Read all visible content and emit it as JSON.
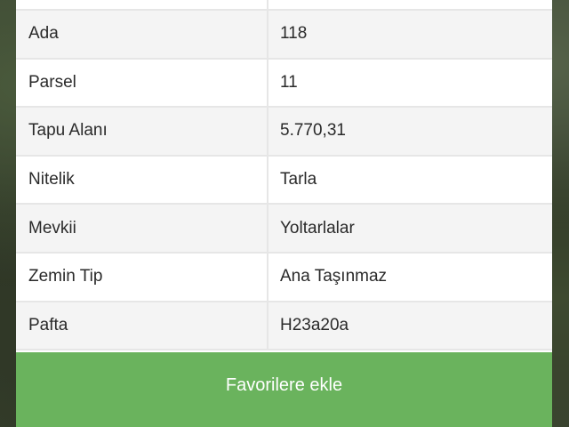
{
  "parcel_info": {
    "rows": [
      {
        "label": "",
        "value": ""
      },
      {
        "label": "Ada",
        "value": "118"
      },
      {
        "label": "Parsel",
        "value": "11"
      },
      {
        "label": "Tapu Alanı",
        "value": "5.770,31"
      },
      {
        "label": "Nitelik",
        "value": "Tarla"
      },
      {
        "label": "Mevkii",
        "value": "Yoltarlalar"
      },
      {
        "label": "Zemin Tip",
        "value": "Ana Taşınmaz"
      },
      {
        "label": "Pafta",
        "value": "H23a20a"
      }
    ]
  },
  "actions": {
    "favorite_label": "Favorilere ekle"
  },
  "colors": {
    "button_green": "#6ab35d",
    "row_alt": "#f4f4f4",
    "divider": "#e6e6e6"
  }
}
